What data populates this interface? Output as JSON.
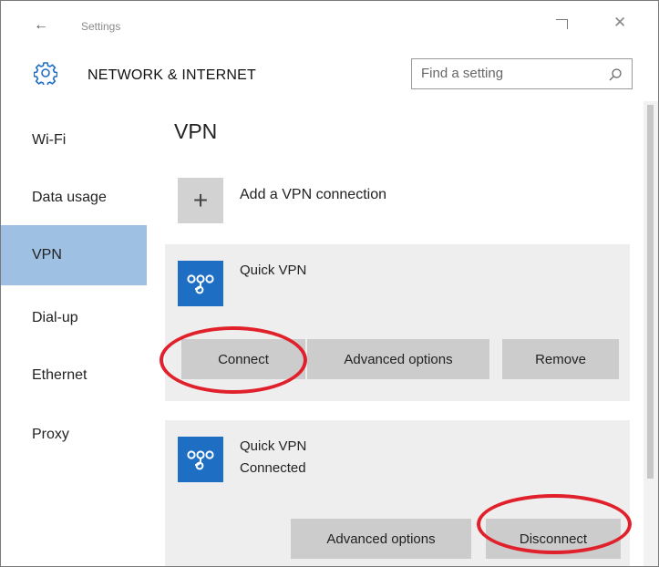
{
  "window": {
    "title": "Settings",
    "back_icon": "arrow-left-icon",
    "restore_icon": "restore-icon",
    "close_icon": "close-icon"
  },
  "header": {
    "icon": "gear-icon",
    "title": "NETWORK & INTERNET",
    "search": {
      "placeholder": "Find a setting",
      "icon": "search-icon"
    }
  },
  "sidebar": {
    "items": [
      {
        "label": "Wi-Fi"
      },
      {
        "label": "Data usage"
      },
      {
        "label": "VPN",
        "active": true
      },
      {
        "label": "Dial-up"
      },
      {
        "label": "Ethernet"
      },
      {
        "label": "Proxy"
      }
    ],
    "active_color": "#9ec0e2"
  },
  "main": {
    "title": "VPN",
    "add": {
      "icon": "plus-icon",
      "label": "Add a VPN connection"
    },
    "connections": [
      {
        "name": "Quick VPN",
        "status": "",
        "icon": "vpn-icon",
        "buttons": {
          "connect": "Connect",
          "advanced": "Advanced options",
          "remove": "Remove"
        }
      },
      {
        "name": "Quick VPN",
        "status": "Connected",
        "icon": "vpn-icon",
        "buttons": {
          "advanced": "Advanced options",
          "disconnect": "Disconnect"
        }
      }
    ],
    "tile_color": "#1e6fc4",
    "annotation_color": "#e0202a"
  }
}
